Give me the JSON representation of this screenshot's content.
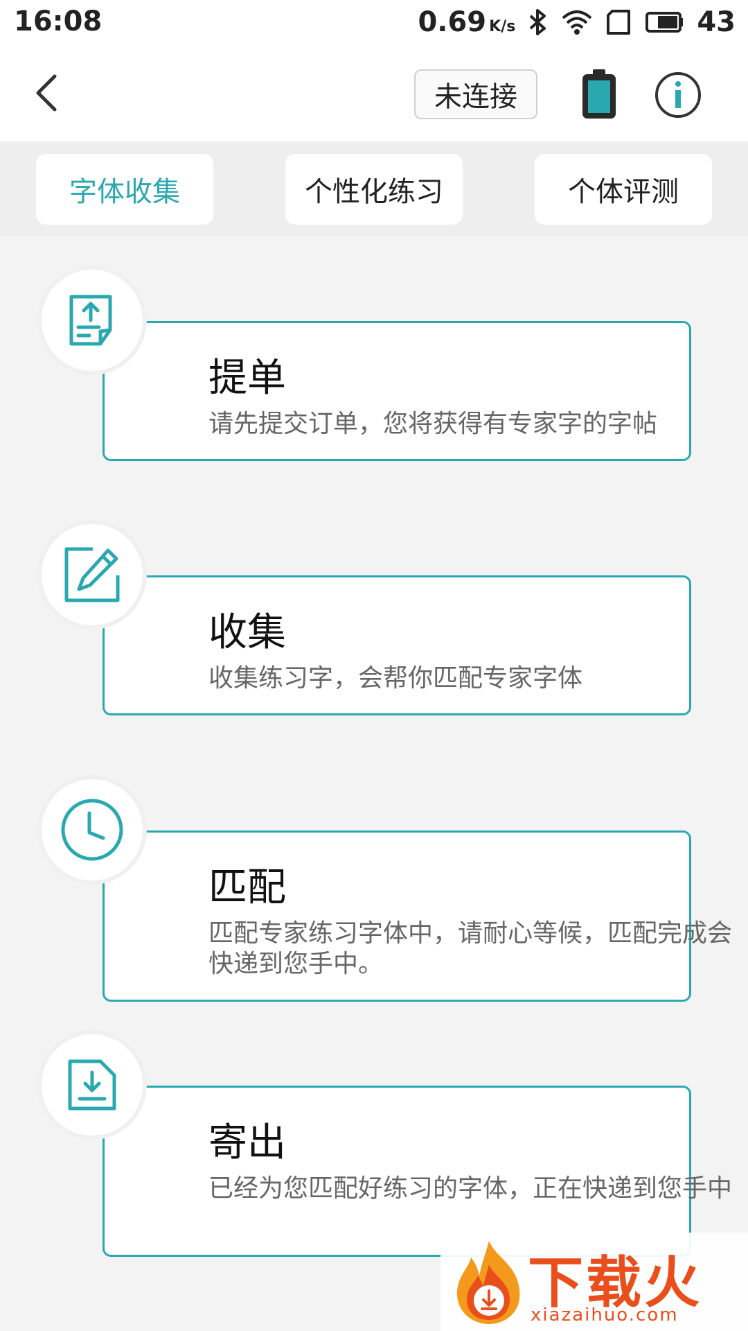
{
  "status_bar": {
    "time": "16:08",
    "net_speed": "0.69",
    "net_unit": "K/s",
    "battery_level": "43"
  },
  "header": {
    "connect_label": "未连接",
    "icons": [
      "back-arrow-icon",
      "device-battery-icon",
      "info-icon"
    ]
  },
  "tabs": [
    {
      "label": "字体收集",
      "active": true
    },
    {
      "label": "个性化练习",
      "active": false
    },
    {
      "label": "个体评测",
      "active": false
    }
  ],
  "steps": [
    {
      "icon": "upload-document-icon",
      "title": "提单",
      "desc": "请先提交订单，您将获得有专家字的字帖"
    },
    {
      "icon": "edit-icon",
      "title": "收集",
      "desc": "收集练习字，会帮你匹配专家字体"
    },
    {
      "icon": "clock-icon",
      "title": "匹配",
      "desc": "匹配专家练习字体中，请耐心等候，匹配完成会快递到您手中。"
    },
    {
      "icon": "download-document-icon",
      "title": "寄出",
      "desc": "已经为您匹配好练习的字体，正在快递到您手中"
    }
  ],
  "watermark": {
    "name": "下载火",
    "url": "xiazaihuo.com"
  },
  "colors": {
    "accent": "#2aa8b0",
    "background": "#f3f3f3",
    "watermark": "#e94e1b"
  }
}
